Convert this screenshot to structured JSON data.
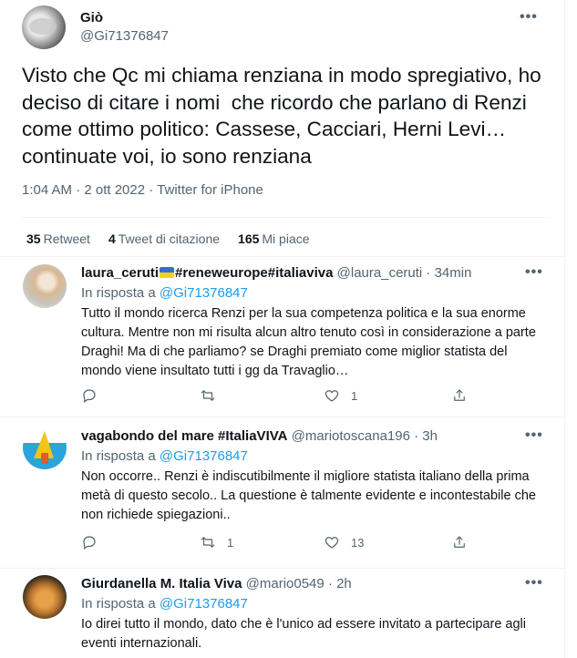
{
  "main_tweet": {
    "name": "Giò",
    "handle": "@Gi71376847",
    "more": "•••",
    "text": "Visto che Qc mi chiama renziana in modo spregiativo, ho deciso di citare i nomi  che ricordo che parlano di Renzi  come ottimo politico: Cassese, Cacciari, Herni Levi… continuate voi, io sono renziana",
    "meta": "1:04 AM · 2 ott 2022 · Twitter for iPhone",
    "stats": [
      {
        "count": "35",
        "label": "Retweet"
      },
      {
        "count": "4",
        "label": "Tweet di citazione"
      },
      {
        "count": "165",
        "label": "Mi piace"
      }
    ]
  },
  "replies": [
    {
      "name_a": "laura_ceruti",
      "name_b": "#reneweurope#italiaviva",
      "handle_time": "@laura_ceruti · 34min",
      "reply_prefix": "In risposta a ",
      "reply_to": "@Gi71376847",
      "text": "Tutto il mondo ricerca Renzi per la sua competenza politica e la sua enorme cultura. Mentre non mi risulta alcun altro tenuto così in considerazione a parte Draghi! Ma di che parliamo?  se Draghi premiato come miglior statista del mondo viene insultato tutti i gg da Travaglio…",
      "retweets": "",
      "likes": "1",
      "more": "•••"
    },
    {
      "name": "vagabondo del mare #ItaliaVIVA",
      "handle_time": "@mariotoscana196 · 3h",
      "reply_prefix": "In risposta a ",
      "reply_to": "@Gi71376847",
      "text": "Non occorre.. Renzi è indiscutibilmente il migliore statista italiano della prima metà di questo secolo.. La questione è talmente evidente e incontestabile che non richiede spiegazioni..",
      "retweets": "1",
      "likes": "13",
      "more": "•••"
    },
    {
      "name": "Giurdanella M. Italia Viva",
      "handle_time": "@mario0549 · 2h",
      "reply_prefix": "In risposta a ",
      "reply_to": "@Gi71376847",
      "text": "Io direi tutto il mondo, dato che è l'unico ad essere invitato a partecipare agli eventi internazionali.",
      "more": "•••"
    }
  ],
  "colors": {
    "link": "#1d9bf0",
    "secondary": "#536471",
    "text": "#0f1419",
    "border": "#eff3f4"
  },
  "icons": [
    "reply-icon",
    "retweet-icon",
    "like-icon",
    "share-icon"
  ]
}
